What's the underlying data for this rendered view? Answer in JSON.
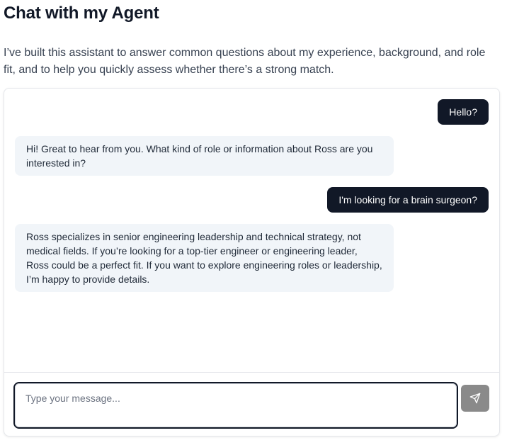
{
  "header": {
    "title": "Chat with my Agent",
    "intro": "I’ve built this assistant to answer common questions about my experience, background, and role fit, and to help you quickly assess whether there’s a strong match."
  },
  "chat": {
    "messages": [
      {
        "role": "user",
        "text": "Hello?"
      },
      {
        "role": "assistant",
        "text": "Hi! Great to hear from you. What kind of role or information about Ross are you interested in?"
      },
      {
        "role": "user",
        "text": "I'm looking for a brain surgeon?"
      },
      {
        "role": "assistant",
        "text": "Ross specializes in senior engineering leadership and technical strategy, not medical fields. If you’re looking for a top-tier engineer or engineering leader, Ross could be a perfect fit. If you want to explore engineering roles or leadership, I’m happy to provide details."
      }
    ]
  },
  "composer": {
    "placeholder": "Type your message...",
    "value": "",
    "send_icon": "paper-plane-icon",
    "send_button_color": "#8a8a8a"
  },
  "colors": {
    "user_bubble": "#111827",
    "assistant_bubble": "#f1f5f9",
    "title": "#111827"
  }
}
